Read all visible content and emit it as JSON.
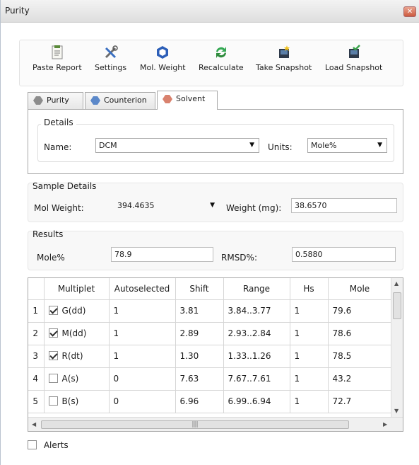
{
  "window": {
    "title": "Purity"
  },
  "toolbar": {
    "paste_report": "Paste Report",
    "settings": "Settings",
    "mol_weight": "Mol. Weight",
    "recalculate": "Recalculate",
    "take_snapshot": "Take Snapshot",
    "load_snapshot": "Load Snapshot"
  },
  "tabs": {
    "purity": "Purity",
    "counterion": "Counterion",
    "solvent": "Solvent"
  },
  "details": {
    "title": "Details",
    "name_label": "Name:",
    "name_value": "DCM",
    "units_label": "Units:",
    "units_value": "Mole%"
  },
  "sample_details": {
    "title": "Sample Details",
    "mol_weight_label": "Mol Weight:",
    "mol_weight_value": "394.4635",
    "weight_label": "Weight (mg):",
    "weight_value": "38.6570"
  },
  "results": {
    "title": "Results",
    "mole_label": "Mole%",
    "mole_value": "78.9",
    "rmsd_label": "RMSD%:",
    "rmsd_value": "0.5880"
  },
  "table": {
    "headers": [
      "Multiplet",
      "Autoselected",
      "Shift",
      "Range",
      "Hs",
      "Mole"
    ],
    "rows": [
      {
        "n": "1",
        "checked": true,
        "multiplet": "G(dd)",
        "auto": "1",
        "shift": "3.81",
        "range": "3.84..3.77",
        "hs": "1",
        "mole": "79.6"
      },
      {
        "n": "2",
        "checked": true,
        "multiplet": "M(dd)",
        "auto": "1",
        "shift": "2.89",
        "range": "2.93..2.84",
        "hs": "1",
        "mole": "78.6"
      },
      {
        "n": "3",
        "checked": true,
        "multiplet": "R(dt)",
        "auto": "1",
        "shift": "1.30",
        "range": "1.33..1.26",
        "hs": "1",
        "mole": "78.5"
      },
      {
        "n": "4",
        "checked": false,
        "multiplet": "A(s)",
        "auto": "0",
        "shift": "7.63",
        "range": "7.67..7.61",
        "hs": "1",
        "mole": "43.2"
      },
      {
        "n": "5",
        "checked": false,
        "multiplet": "B(s)",
        "auto": "0",
        "shift": "6.96",
        "range": "6.99..6.94",
        "hs": "1",
        "mole": "72.7"
      }
    ]
  },
  "alerts": {
    "label": "Alerts",
    "checked": false
  },
  "icons": {
    "paste_report": "paste-report-icon",
    "settings": "settings-tools-icon",
    "mol_weight": "mol-weight-hexagon-icon",
    "recalculate": "recalculate-arrows-icon",
    "take_snapshot": "take-snapshot-icon",
    "load_snapshot": "load-snapshot-icon"
  },
  "colors": {
    "accent_blue": "#2d5fb8",
    "recalc_green": "#34a853",
    "solvent_tab": "#d9826e"
  }
}
